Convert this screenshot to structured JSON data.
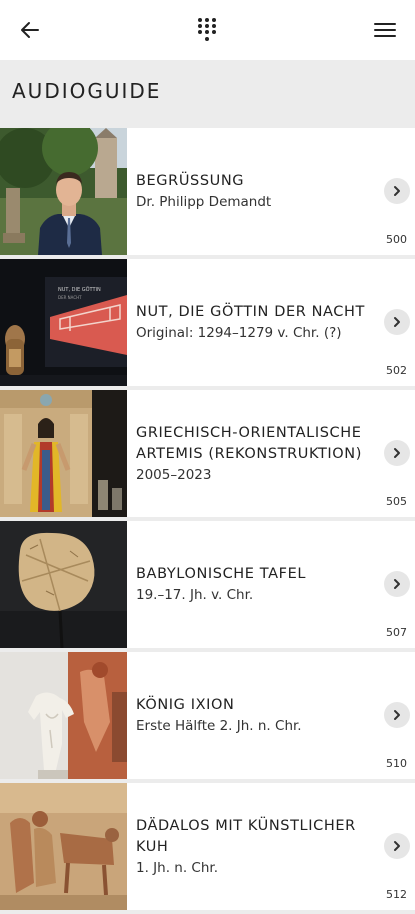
{
  "topbar": {
    "back_icon": "arrow-left-icon",
    "keypad_icon": "keypad-icon",
    "menu_icon": "hamburger-menu-icon"
  },
  "section": {
    "title": "AUDIOGUIDE"
  },
  "items": [
    {
      "title": "BEGRÜSSUNG",
      "subtitle": "Dr. Philipp Demandt",
      "number": "500",
      "image": "man-in-suit-in-garden-photo"
    },
    {
      "title": "NUT, DIE GÖTTIN DER NACHT",
      "subtitle": "Original: 1294–1279 v. Chr. (?)",
      "number": "502",
      "image": "egyptian-exhibit-photo"
    },
    {
      "title": "GRIECHISCH-ORIENTALISCHE ARTEMIS (REKONSTRUKTION)",
      "subtitle": "2005–2023",
      "number": "505",
      "image": "painted-artemis-statue-photo"
    },
    {
      "title": "BABYLONISCHE TAFEL",
      "subtitle": "19.–17. Jh. v. Chr.",
      "number": "507",
      "image": "clay-tablet-photo"
    },
    {
      "title": "KÖNIG IXION",
      "subtitle": "Erste Hälfte 2. Jh. n. Chr.",
      "number": "510",
      "image": "marble-torso-photo"
    },
    {
      "title": "DÄDALOS MIT KÜNSTLICHER KUH",
      "subtitle": "1. Jh. n. Chr.",
      "number": "512",
      "image": "fresco-painting-photo"
    }
  ]
}
